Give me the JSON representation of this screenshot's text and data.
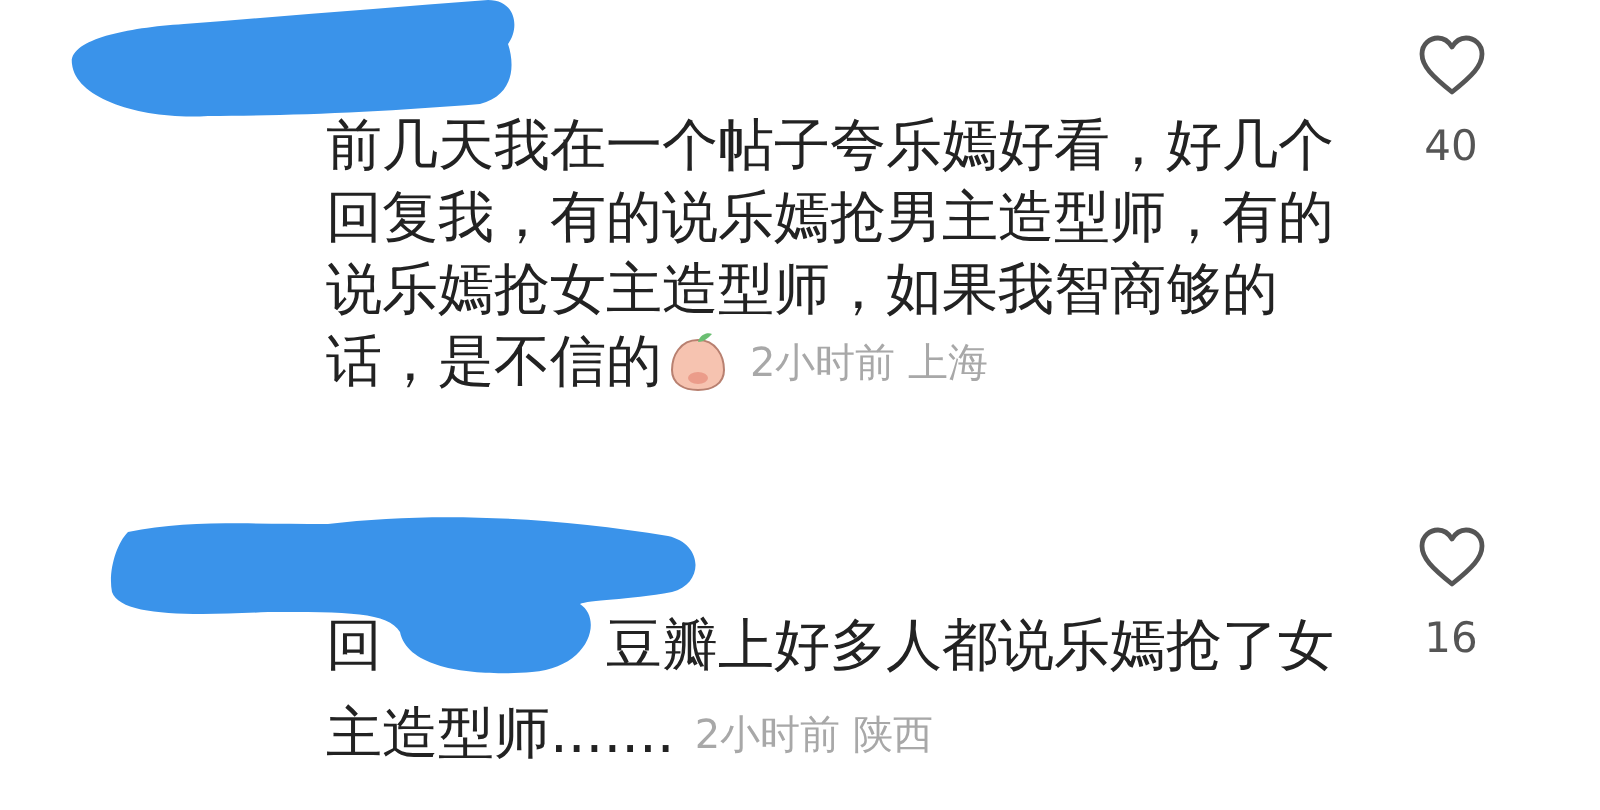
{
  "comments": [
    {
      "text_lines": [
        "前几天我在一个帖子夸乐嫣好看，好几个",
        "回复我，有的说乐嫣抢男主造型师，有的",
        "说乐嫣抢女主造型师，如果我智商够的",
        "话，是不信的"
      ],
      "sticker": true,
      "meta": "2小时前 上海",
      "likes": "40"
    },
    {
      "reply_prefix": "回",
      "text_lines": [
        "豆瓣上好多人都说乐嫣抢了女",
        "主造型师......."
      ],
      "sticker": false,
      "meta": "2小时前 陕西",
      "likes": "16"
    }
  ]
}
